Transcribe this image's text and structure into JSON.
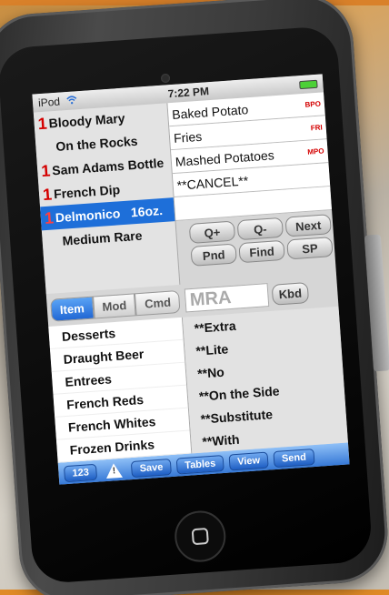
{
  "status": {
    "carrier": "iPod",
    "time": "7:22 PM"
  },
  "order": [
    {
      "qty": "1",
      "label": "Bloody Mary",
      "mod": false
    },
    {
      "qty": "",
      "label": "On the Rocks",
      "mod": true
    },
    {
      "qty": "1",
      "label": "Sam Adams Bottle",
      "mod": false
    },
    {
      "qty": "1",
      "label": "French Dip",
      "mod": false
    },
    {
      "qty": "1",
      "label": "Delmonico   16oz.",
      "mod": false,
      "selected": true
    },
    {
      "qty": "",
      "label": "Medium Rare",
      "mod": true
    }
  ],
  "items": [
    {
      "label": "Baked Potato",
      "code": "BPO"
    },
    {
      "label": "Fries",
      "code": "FRI"
    },
    {
      "label": "Mashed Potatoes",
      "code": "MPO"
    },
    {
      "label": "**CANCEL**",
      "code": ""
    }
  ],
  "keys": [
    "Q+",
    "Q-",
    "Next",
    "Pnd",
    "Find",
    "SP"
  ],
  "tabs": [
    "Item",
    "Mod",
    "Cmd"
  ],
  "input_value": "MRA",
  "kbd_label": "Kbd",
  "categories": [
    "Desserts",
    "Draught Beer",
    "Entrees",
    "French Reds",
    "French Whites",
    "Frozen Drinks"
  ],
  "modifiers": [
    "**Extra",
    "**Lite",
    "**No",
    "**On the Side",
    "**Substitute",
    "**With"
  ],
  "toolbar": {
    "num": "123",
    "warn": "!",
    "save": "Save",
    "tables": "Tables",
    "view": "View",
    "send": "Send"
  },
  "colors": {
    "accent": "#1e6fd9",
    "qty_red": "#d40000",
    "toolbar_blue": "#2f73d4"
  }
}
